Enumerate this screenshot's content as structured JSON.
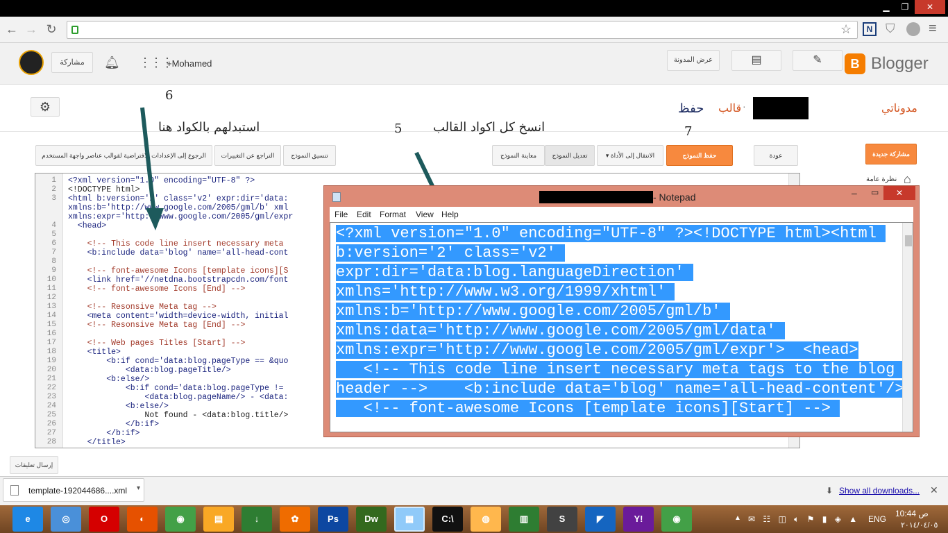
{
  "browser": {
    "window_buttons": [
      "▁",
      "❐",
      "✕"
    ],
    "nav_back": "←",
    "nav_forward": "→",
    "nav_reload": "↻"
  },
  "blogger": {
    "brand": "Blogger",
    "user_name": "+Mohamed",
    "share_label": "مشاركة",
    "view_blog_label": "عرض المدونة",
    "my_blogs": "مدوناتي",
    "breadcrumb_sep": "·",
    "template_label": "قالب",
    "new_post": "مشاركة جديدة",
    "overview": "نظرة عامة",
    "feedback": "إرسال تعليقات",
    "toolbar": {
      "back": "عودة",
      "save_template": "حفظ النموذج",
      "jump_to_widget": "الانتقال إلى الأداة",
      "edit_template": "تعديل النموذج",
      "preview_template": "معاينة النموذج",
      "format_template": "تنسيق النموذج",
      "revert_changes": "التراجع عن التغييرات",
      "revert_widgets": "الرجوع إلى الإعدادات الافتراضية لقوالب عناصر واجهة المستخدم"
    }
  },
  "annotations": {
    "save_word": "حفظ",
    "step6": "6",
    "step5": "5",
    "step7": "7",
    "copy_instruction": "انسخ كل اكواد القالب",
    "replace_instruction": "استبدلهم بالكواد هنا"
  },
  "editor": {
    "lines": [
      {
        "n": "1",
        "t": "<?xml version=\"1.0\" encoding=\"UTF-8\" ?>",
        "c": "tg"
      },
      {
        "n": "2",
        "t": "<!DOCTYPE html>",
        "c": ""
      },
      {
        "n": "3",
        "t": "<html b:version='2' class='v2' expr:dir='data:",
        "c": "tg"
      },
      {
        "n": "",
        "t": "xmlns:b='http://www.google.com/2005/gml/b' xml",
        "c": "tg"
      },
      {
        "n": "",
        "t": "xmlns:expr='http://www.google.com/2005/gml/expr",
        "c": "tg"
      },
      {
        "n": "4",
        "t": "  <head>",
        "c": "tg"
      },
      {
        "n": "5",
        "t": "",
        "c": ""
      },
      {
        "n": "6",
        "t": "    <!-- This code line insert necessary meta",
        "c": "cm"
      },
      {
        "n": "7",
        "t": "    <b:include data='blog' name='all-head-cont",
        "c": "tg"
      },
      {
        "n": "8",
        "t": "",
        "c": ""
      },
      {
        "n": "9",
        "t": "    <!-- font-awesome Icons [template icons][S",
        "c": "cm"
      },
      {
        "n": "10",
        "t": "    <link href='//netdna.bootstrapcdn.com/font",
        "c": "tg"
      },
      {
        "n": "11",
        "t": "    <!-- font-awesome Icons [End] -->",
        "c": "cm"
      },
      {
        "n": "12",
        "t": "",
        "c": ""
      },
      {
        "n": "13",
        "t": "    <!-- Resonsive Meta tag -->",
        "c": "cm"
      },
      {
        "n": "14",
        "t": "    <meta content='width=device-width, initial",
        "c": "tg"
      },
      {
        "n": "15",
        "t": "    <!-- Resonsive Meta tag [End] -->",
        "c": "cm"
      },
      {
        "n": "16",
        "t": "",
        "c": ""
      },
      {
        "n": "17",
        "t": "    <!-- Web pages Titles [Start] -->",
        "c": "cm"
      },
      {
        "n": "18",
        "t": "    <title>",
        "c": "tg"
      },
      {
        "n": "19",
        "t": "        <b:if cond='data:blog.pageType == &quo",
        "c": "tg"
      },
      {
        "n": "20",
        "t": "            <data:blog.pageTitle/>",
        "c": "tg"
      },
      {
        "n": "21",
        "t": "        <b:else/>",
        "c": "tg"
      },
      {
        "n": "22",
        "t": "            <b:if cond='data:blog.pageType != ",
        "c": "tg"
      },
      {
        "n": "23",
        "t": "                <data:blog.pageName/> - <data:",
        "c": "tg"
      },
      {
        "n": "24",
        "t": "            <b:else/>",
        "c": "tg"
      },
      {
        "n": "25",
        "t": "                Not found - <data:blog.title/>",
        "c": ""
      },
      {
        "n": "26",
        "t": "            </b:if>",
        "c": "tg"
      },
      {
        "n": "27",
        "t": "        </b:if>",
        "c": "tg"
      },
      {
        "n": "28",
        "t": "    </title>",
        "c": "tg"
      }
    ]
  },
  "notepad": {
    "title": "- Notepad",
    "menu": [
      "File",
      "Edit",
      "Format",
      "View",
      "Help"
    ],
    "lines": [
      "<?xml version=\"1.0\" encoding=\"UTF-8\" ?><!DOCTYPE html><html ",
      "b:version='2' class='v2' ",
      "expr:dir='data:blog.languageDirection' ",
      "xmlns='http://www.w3.org/1999/xhtml' ",
      "xmlns:b='http://www.google.com/2005/gml/b' ",
      "xmlns:data='http://www.google.com/2005/gml/data' ",
      "xmlns:expr='http://www.google.com/2005/gml/expr'>  <head>",
      "   <!-- This code line insert necessary meta tags to the blog ",
      "header -->    <b:include data='blog' name='all-head-content'/>",
      "   <!-- font-awesome Icons [template icons][Start] --> "
    ]
  },
  "downloads": {
    "file": "template-192044686....xml",
    "show_all": "Show all downloads..."
  },
  "taskbar": {
    "apps": [
      {
        "name": "ie-icon",
        "label": "e",
        "color": "#1e88e5"
      },
      {
        "name": "safari-icon",
        "label": "◎",
        "color": "#4a90d9"
      },
      {
        "name": "opera-icon",
        "label": "O",
        "color": "#d50000"
      },
      {
        "name": "firefox-icon",
        "label": "◐",
        "color": "#e65100"
      },
      {
        "name": "chrome-icon",
        "label": "◉",
        "color": "#43a047"
      },
      {
        "name": "explorer-icon",
        "label": "▤",
        "color": "#f9a825"
      },
      {
        "name": "idm-icon",
        "label": "↓",
        "color": "#2e7d32"
      },
      {
        "name": "paint-icon",
        "label": "✿",
        "color": "#ef6c00"
      },
      {
        "name": "photoshop-icon",
        "label": "Ps",
        "color": "#0d47a1"
      },
      {
        "name": "dreamweaver-icon",
        "label": "Dw",
        "color": "#33691e"
      },
      {
        "name": "notepad-icon",
        "label": "▦",
        "color": "#90caf9"
      },
      {
        "name": "cmd-icon",
        "label": "C:\\",
        "color": "#111111"
      },
      {
        "name": "app-icon",
        "label": "◍",
        "color": "#ffb74d"
      },
      {
        "name": "excel-icon",
        "label": "▥",
        "color": "#2e7d32"
      },
      {
        "name": "sublime-icon",
        "label": "S",
        "color": "#424242"
      },
      {
        "name": "shark-icon",
        "label": "◤",
        "color": "#1565c0"
      },
      {
        "name": "yahoo-icon",
        "label": "Y!",
        "color": "#6a1b9a"
      },
      {
        "name": "chrome2-icon",
        "label": "◉",
        "color": "#43a047"
      }
    ],
    "language": "ENG",
    "time": "10:44",
    "ampm": "ص",
    "date": "٢٠١٤/٠٤/٠٥"
  }
}
